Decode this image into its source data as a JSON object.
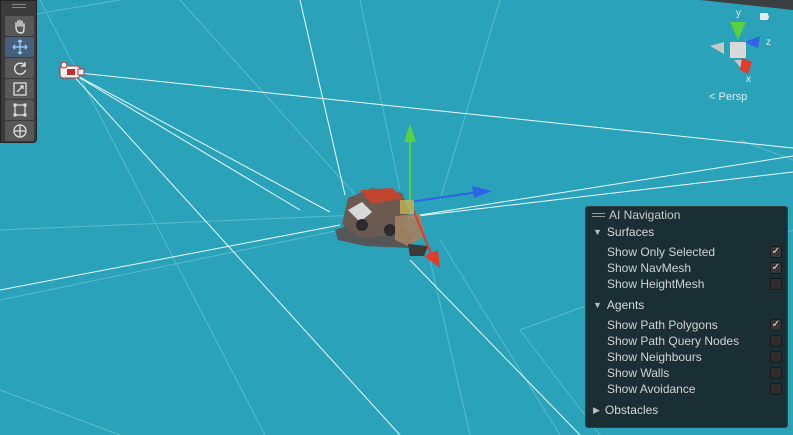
{
  "scene_gizmo": {
    "axis_y": "y",
    "axis_z": "z",
    "axis_x": "x",
    "projection_label": "Persp"
  },
  "tools": [
    {
      "name": "hand-tool",
      "active": false
    },
    {
      "name": "move-tool",
      "active": true
    },
    {
      "name": "rotate-tool",
      "active": false
    },
    {
      "name": "scale-tool",
      "active": false
    },
    {
      "name": "rect-tool",
      "active": false
    },
    {
      "name": "transform-tool",
      "active": false
    }
  ],
  "ai_navigation": {
    "title": "AI Navigation",
    "surfaces": {
      "label": "Surfaces",
      "expanded": true,
      "options": [
        {
          "label": "Show Only Selected",
          "checked": true
        },
        {
          "label": "Show NavMesh",
          "checked": true
        },
        {
          "label": "Show HeightMesh",
          "checked": false
        }
      ]
    },
    "agents": {
      "label": "Agents",
      "expanded": true,
      "options": [
        {
          "label": "Show Path Polygons",
          "checked": true
        },
        {
          "label": "Show Path Query Nodes",
          "checked": false
        },
        {
          "label": "Show Neighbours",
          "checked": false
        },
        {
          "label": "Show Walls",
          "checked": false
        },
        {
          "label": "Show Avoidance",
          "checked": false
        }
      ]
    },
    "obstacles": {
      "label": "Obstacles",
      "expanded": false
    }
  },
  "colors": {
    "ground": "#2aa3ba",
    "navmesh_line": "#e6f4f7",
    "x_axis": "#e03b2b",
    "y_axis": "#58d23c",
    "z_axis": "#2f63e8"
  }
}
